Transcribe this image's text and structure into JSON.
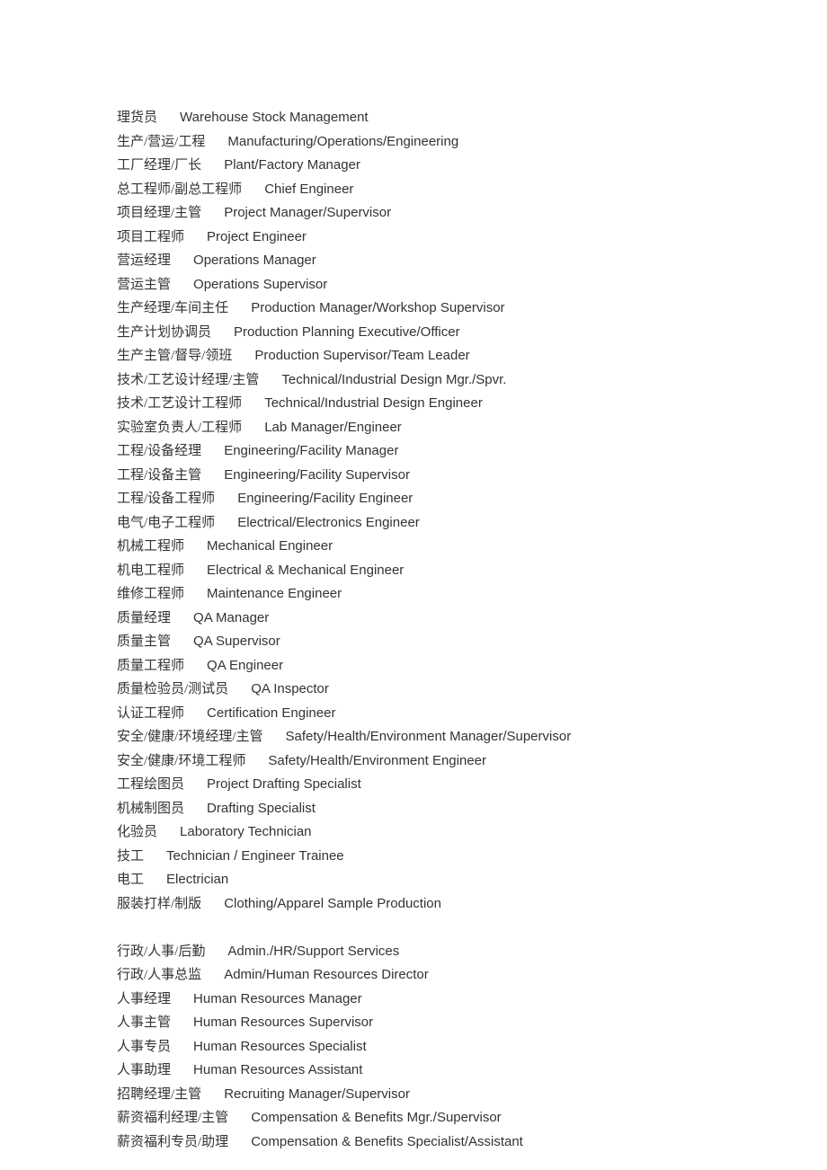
{
  "items": [
    {
      "cn": "理货员",
      "en": "Warehouse Stock Management"
    },
    {
      "cn": "生产/营运/工程",
      "en": "Manufacturing/Operations/Engineering"
    },
    {
      "cn": "工厂经理/厂长",
      "en": "Plant/Factory Manager"
    },
    {
      "cn": "总工程师/副总工程师",
      "en": "Chief Engineer"
    },
    {
      "cn": "项目经理/主管",
      "en": "Project Manager/Supervisor"
    },
    {
      "cn": "项目工程师",
      "en": "Project Engineer"
    },
    {
      "cn": "营运经理",
      "en": "Operations Manager"
    },
    {
      "cn": "营运主管",
      "en": "Operations Supervisor"
    },
    {
      "cn": "生产经理/车间主任",
      "en": "Production Manager/Workshop Supervisor"
    },
    {
      "cn": "生产计划协调员",
      "en": "Production Planning Executive/Officer"
    },
    {
      "cn": "生产主管/督导/领班",
      "en": "Production Supervisor/Team Leader"
    },
    {
      "cn": "技术/工艺设计经理/主管",
      "en": "Technical/Industrial Design Mgr./Spvr."
    },
    {
      "cn": "技术/工艺设计工程师",
      "en": "Technical/Industrial Design Engineer"
    },
    {
      "cn": "实验室负责人/工程师",
      "en": "Lab Manager/Engineer"
    },
    {
      "cn": "工程/设备经理",
      "en": "Engineering/Facility Manager"
    },
    {
      "cn": "工程/设备主管",
      "en": "Engineering/Facility Supervisor"
    },
    {
      "cn": "工程/设备工程师",
      "en": "Engineering/Facility Engineer"
    },
    {
      "cn": "电气/电子工程师",
      "en": "Electrical/Electronics Engineer"
    },
    {
      "cn": "机械工程师",
      "en": "Mechanical Engineer"
    },
    {
      "cn": "机电工程师",
      "en": "Electrical & Mechanical Engineer"
    },
    {
      "cn": "维修工程师",
      "en": "Maintenance Engineer"
    },
    {
      "cn": "质量经理",
      "en": "QA Manager"
    },
    {
      "cn": "质量主管",
      "en": "QA Supervisor"
    },
    {
      "cn": "质量工程师",
      "en": "QA Engineer"
    },
    {
      "cn": "质量检验员/测试员",
      "en": "QA Inspector"
    },
    {
      "cn": "认证工程师",
      "en": "Certification Engineer"
    },
    {
      "cn": "安全/健康/环境经理/主管",
      "en": "Safety/Health/Environment Manager/Supervisor"
    },
    {
      "cn": "安全/健康/环境工程师",
      "en": "Safety/Health/Environment Engineer"
    },
    {
      "cn": "工程绘图员",
      "en": "Project Drafting Specialist"
    },
    {
      "cn": "机械制图员",
      "en": "Drafting Specialist"
    },
    {
      "cn": "化验员",
      "en": "Laboratory Technician"
    },
    {
      "cn": "技工",
      "en": "Technician / Engineer Trainee"
    },
    {
      "cn": "电工",
      "en": "Electrician"
    },
    {
      "cn": "服装打样/制版",
      "en": "Clothing/Apparel Sample Production"
    },
    {
      "blank": true
    },
    {
      "cn": "行政/人事/后勤",
      "en": "Admin./HR/Support Services"
    },
    {
      "cn": "行政/人事总监",
      "en": "Admin/Human Resources Director"
    },
    {
      "cn": "人事经理",
      "en": "Human Resources Manager"
    },
    {
      "cn": "人事主管",
      "en": "Human Resources Supervisor"
    },
    {
      "cn": "人事专员",
      "en": "Human Resources Specialist"
    },
    {
      "cn": "人事助理",
      "en": "Human Resources Assistant"
    },
    {
      "cn": "招聘经理/主管",
      "en": "Recruiting Manager/Supervisor"
    },
    {
      "cn": "薪资福利经理/主管",
      "en": "Compensation & Benefits Mgr./Supervisor"
    },
    {
      "cn": "薪资福利专员/助理",
      "en": "Compensation & Benefits Specialist/Assistant"
    }
  ]
}
